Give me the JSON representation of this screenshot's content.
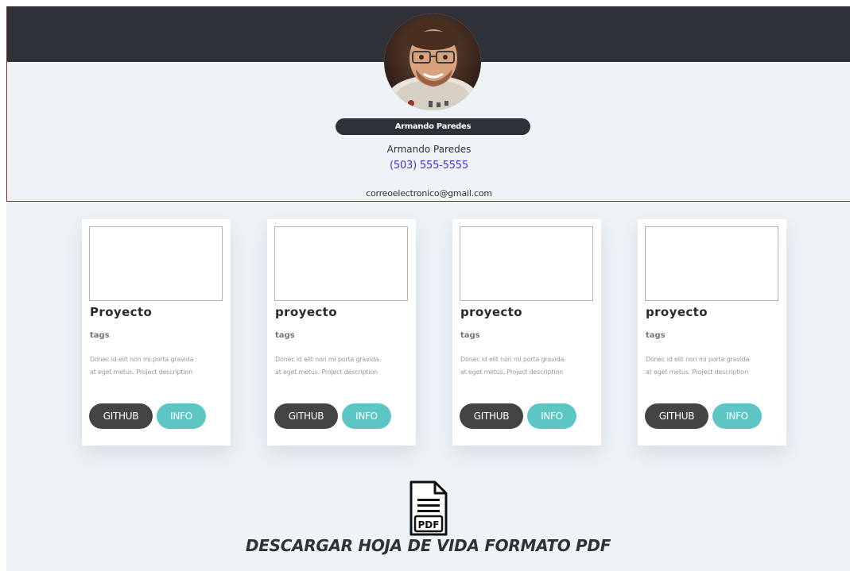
{
  "colors": {
    "header_band": "#2e3138",
    "background": "#eef3f7",
    "github_button": "#444444",
    "info_button": "#5ec5c5",
    "phone_link": "#3a3ac8"
  },
  "profile": {
    "avatar_icon": "profile-photo",
    "name_badge": "Armando Paredes",
    "name": "Armando Paredes",
    "phone": "(503) 555-5555",
    "email": "correoelectronico@gmail.com"
  },
  "projects": [
    {
      "title": "Proyecto",
      "tags": "tags",
      "description": "Donec id elit non mi porta gravida at eget metus. Project description",
      "github_label": "GITHUB",
      "info_label": "INFO"
    },
    {
      "title": "proyecto",
      "tags": "tags",
      "description": "Donec id elit non mi porta gravida at eget metus. Project description",
      "github_label": "GITHUB",
      "info_label": "INFO"
    },
    {
      "title": "proyecto",
      "tags": "tags",
      "description": "Donec id elit non mi porta gravida at eget metus. Project description",
      "github_label": "GITHUB",
      "info_label": "INFO"
    },
    {
      "title": "proyecto",
      "tags": "tags",
      "description": "Donec id elit non mi porta gravida at eget metus. Project description",
      "github_label": "GITHUB",
      "info_label": "INFO"
    }
  ],
  "download": {
    "icon": "pdf-file-icon",
    "icon_text": "PDF",
    "label": "DESCARGAR HOJA DE VIDA FORMATO PDF"
  }
}
